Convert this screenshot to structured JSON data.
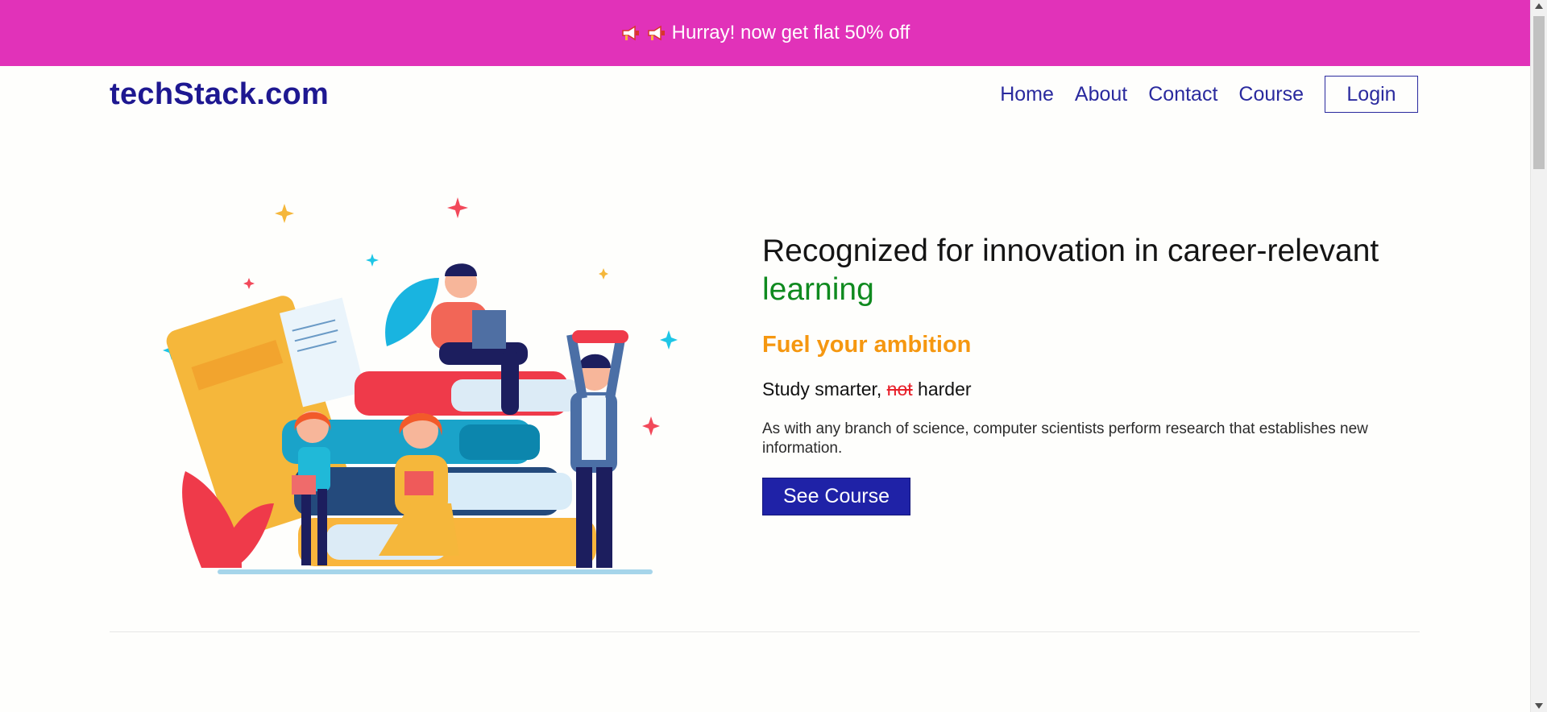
{
  "banner": {
    "icons": [
      "megaphone-icon",
      "megaphone-icon"
    ],
    "text": "Hurray! now get flat 50% off",
    "background": "#e132b9"
  },
  "navbar": {
    "brand": "techStack.com",
    "links": [
      "Home",
      "About",
      "Contact",
      "Course"
    ],
    "login_label": "Login"
  },
  "hero": {
    "headline_main": "Recognized for innovation in career-relevant",
    "headline_highlight": "learning",
    "subhead": "Fuel your ambition",
    "tagline_prefix": "Study smarter,",
    "tagline_strike": "not",
    "tagline_suffix": "harder",
    "description": "As with any branch of science, computer scientists perform research that establishes new information.",
    "cta_label": "See Course"
  },
  "colors": {
    "brand": "#1e1891",
    "accent_green": "#0f8a1f",
    "accent_orange": "#f59710",
    "cta": "#1f22a7",
    "strike_red": "#e8212b"
  }
}
